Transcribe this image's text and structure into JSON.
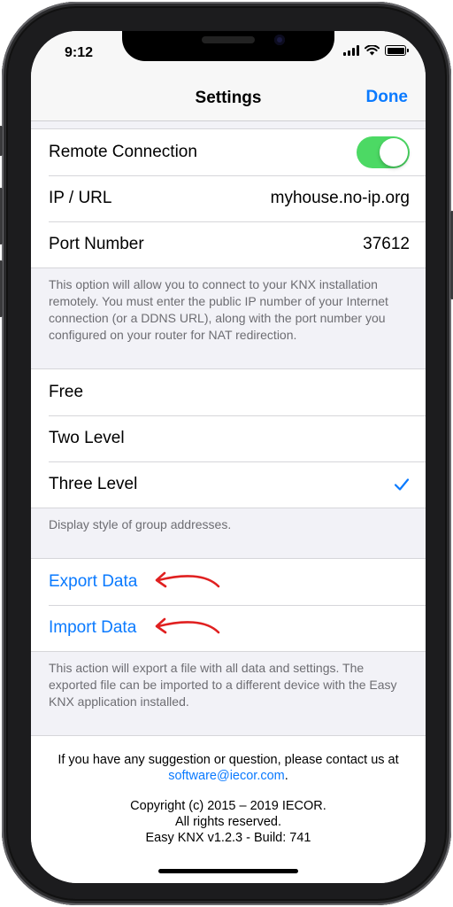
{
  "status_bar": {
    "time": "9:12"
  },
  "nav": {
    "title": "Settings",
    "done_label": "Done"
  },
  "connection": {
    "remote_label": "Remote Connection",
    "remote_enabled": true,
    "ip_label": "IP / URL",
    "ip_value": "myhouse.no-ip.org",
    "port_label": "Port Number",
    "port_value": "37612",
    "note": "This option will allow you to connect to your KNX installation remotely. You must enter the public IP number of your Internet connection (or a DDNS URL), along with the port number you configured on your router for NAT redirection."
  },
  "address_style": {
    "options": [
      {
        "label": "Free",
        "selected": false
      },
      {
        "label": "Two Level",
        "selected": false
      },
      {
        "label": "Three Level",
        "selected": true
      }
    ],
    "note": "Display style of group addresses."
  },
  "data_actions": {
    "export_label": "Export Data",
    "import_label": "Import Data",
    "note": "This action will export a file with all data and settings. The exported file can be imported to a different device with the Easy KNX application installed."
  },
  "about": {
    "contact_text": "If you have any suggestion or question, please contact us at",
    "email": "software@iecor.com",
    "contact_suffix": ".",
    "copyright": "Copyright (c) 2015 – 2019 IECOR.",
    "rights": "All rights reserved.",
    "version": "Easy KNX v1.2.3 - Build: 741"
  },
  "colors": {
    "accent": "#0a7aff",
    "toggle_on": "#4cd964",
    "annotation_arrow": "#e02020"
  }
}
